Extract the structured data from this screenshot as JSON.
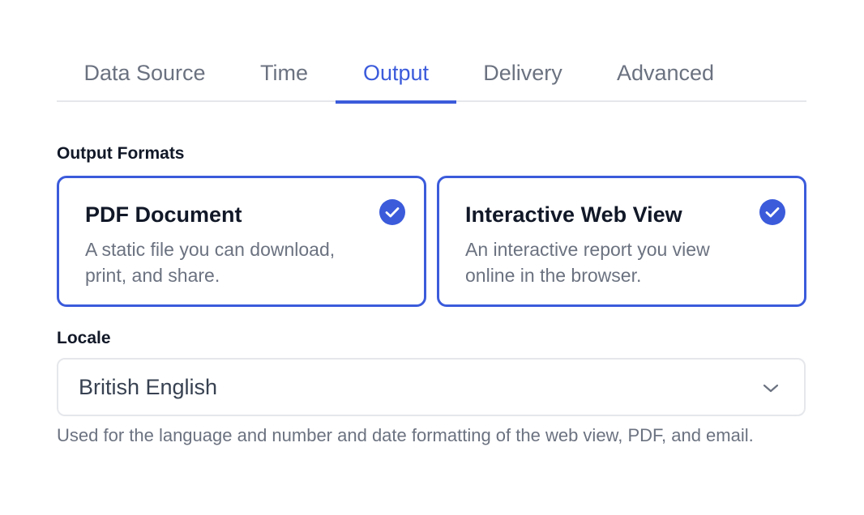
{
  "tabs": [
    {
      "label": "Data Source",
      "active": false
    },
    {
      "label": "Time",
      "active": false
    },
    {
      "label": "Output",
      "active": true
    },
    {
      "label": "Delivery",
      "active": false
    },
    {
      "label": "Advanced",
      "active": false
    }
  ],
  "output_formats": {
    "label": "Output Formats",
    "options": [
      {
        "title": "PDF Document",
        "description": "A static file you can download, print, and share.",
        "selected": true,
        "icon": "check-circle-icon"
      },
      {
        "title": "Interactive Web View",
        "description": "An interactive report you view online in the browser.",
        "selected": true,
        "icon": "check-circle-icon"
      }
    ]
  },
  "locale": {
    "label": "Locale",
    "selected": "British English",
    "icon": "chevron-down-icon",
    "help_text": "Used for the language and number and date formatting of the web view, PDF, and email."
  },
  "colors": {
    "accent": "#3b5bdb",
    "text_primary": "#111827",
    "text_muted": "#6b7280",
    "border": "#e5e7eb"
  }
}
